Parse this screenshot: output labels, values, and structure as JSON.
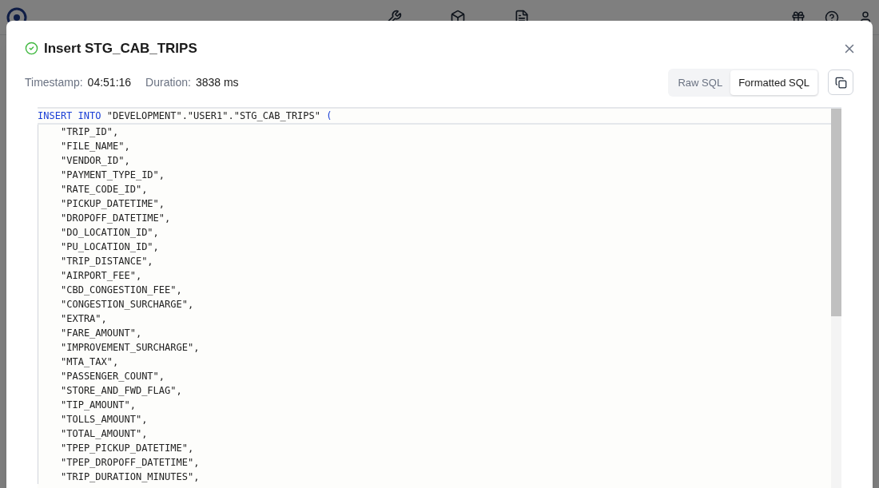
{
  "dialog": {
    "succeeded": true,
    "title": "Insert STG_CAB_TRIPS",
    "meta": [
      {
        "label": "Timestamp:",
        "value": "04:51:16"
      },
      {
        "label": "Duration:",
        "value": "3838 ms"
      }
    ],
    "view_tabs": [
      {
        "label": "Raw SQL",
        "selected": false
      },
      {
        "label": "Formatted SQL",
        "selected": true
      }
    ],
    "code": {
      "tokens": [
        {
          "kind": "keyword",
          "text": "INSERT INTO"
        },
        {
          "kind": "plain",
          "text": " \"DEVELOPMENT\".\"USER1\".\"STG_CAB_TRIPS\" "
        },
        {
          "kind": "keyword",
          "text": "("
        }
      ],
      "children": [
        "\"TRIP_ID\",",
        "\"FILE_NAME\",",
        "\"VENDOR_ID\",",
        "\"PAYMENT_TYPE_ID\",",
        "\"RATE_CODE_ID\",",
        "\"PICKUP_DATETIME\",",
        "\"DROPOFF_DATETIME\",",
        "\"DO_LOCATION_ID\",",
        "\"PU_LOCATION_ID\",",
        "\"TRIP_DISTANCE\",",
        "\"AIRPORT_FEE\",",
        "\"CBD_CONGESTION_FEE\",",
        "\"CONGESTION_SURCHARGE\",",
        "\"EXTRA\",",
        "\"FARE_AMOUNT\",",
        "\"IMPROVEMENT_SURCHARGE\",",
        "\"MTA_TAX\",",
        "\"PASSENGER_COUNT\",",
        "\"STORE_AND_FWD_FLAG\",",
        "\"TIP_AMOUNT\",",
        "\"TOLLS_AMOUNT\",",
        "\"TOTAL_AMOUNT\",",
        "\"TPEP_PICKUP_DATETIME\",",
        "\"TPEP_DROPOFF_DATETIME\",",
        "\"TRIP_DURATION_MINUTES\","
      ]
    }
  }
}
